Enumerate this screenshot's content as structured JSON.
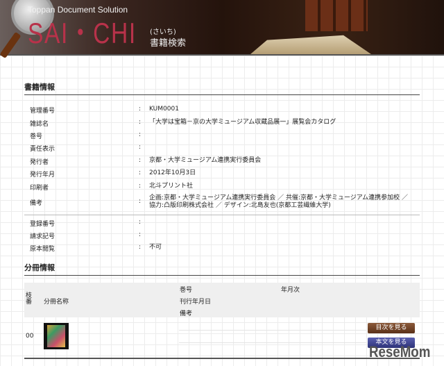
{
  "header": {
    "subtitle": "Toppan Document Solution",
    "logo": "SAI・CHI",
    "kana": "(さいち)",
    "title": "書籍検索"
  },
  "book_info": {
    "heading": "書籍情報",
    "rows": [
      {
        "label": "管理番号",
        "value": "KUM0001"
      },
      {
        "label": "雑誌名",
        "value": "「大学は宝箱－京の大学ミュージアム収蔵品展一」展覧会カタログ"
      },
      {
        "label": "巻号",
        "value": ""
      },
      {
        "label": "責任表示",
        "value": ""
      },
      {
        "label": "発行者",
        "value": "京都・大学ミュージアム連携実行委員会"
      },
      {
        "label": "発行年月",
        "value": "2012年10月3日"
      },
      {
        "label": "印刷者",
        "value": "北斗プリント社"
      },
      {
        "label": "備考",
        "value": "企画:京都・大学ミュージアム連携実行委員会 ／ 共催:京都・大学ミュージアム連携参加校 ／ 協力:凸版印刷株式会社 ／ デザイン:北島友也(京都工芸繊維大学)"
      },
      {
        "label": "登録番号",
        "value": ""
      },
      {
        "label": "請求記号",
        "value": ""
      },
      {
        "label": "原本閲覧",
        "value": "不可"
      }
    ],
    "colon": ":"
  },
  "volumes": {
    "heading": "分冊情報",
    "columns": {
      "branch": "枝番",
      "name": "分冊名称",
      "volume": "巻号",
      "date": "刊行年月日",
      "note": "備考",
      "yearmonth": "年月次"
    },
    "rows": [
      {
        "branch": "00",
        "toc_button": "目次を見る",
        "text_button": "本文を見る"
      }
    ]
  },
  "watermark": "ReseMom"
}
